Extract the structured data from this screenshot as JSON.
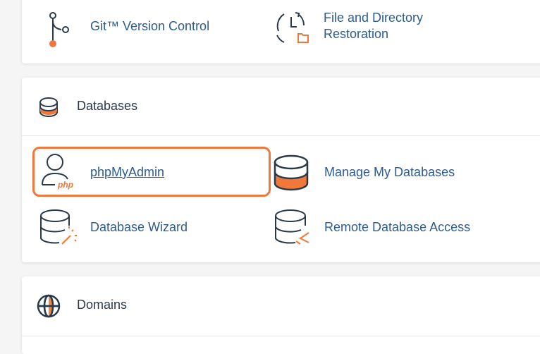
{
  "tools": {
    "git_label": "Git™ Version Control",
    "restore_label_line1": "File and Directory",
    "restore_label_line2": "Restoration"
  },
  "databases": {
    "title": "Databases",
    "items": [
      {
        "label": "phpMyAdmin",
        "icon": "phpmyadmin-icon"
      },
      {
        "label": "Manage My Databases",
        "icon": "database-icon"
      },
      {
        "label": "Database Wizard",
        "icon": "database-wizard-icon"
      },
      {
        "label": "Remote Database Access",
        "icon": "remote-database-icon"
      }
    ],
    "php_badge": "php"
  },
  "domains": {
    "title": "Domains"
  },
  "colors": {
    "accent": "#f0783a",
    "link": "#2d5b8e",
    "icon_stroke": "#293a4a"
  }
}
